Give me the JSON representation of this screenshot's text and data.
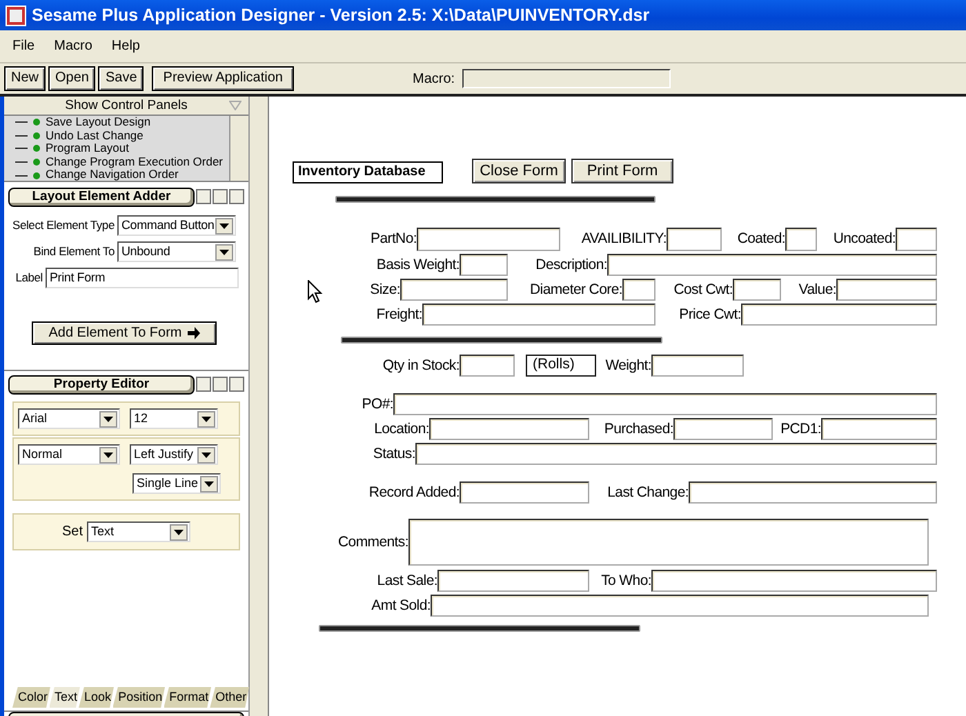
{
  "window": {
    "title": "Sesame Plus Application Designer - Version 2.5: X:\\Data\\PUINVENTORY.dsr"
  },
  "menu": [
    "File",
    "Macro",
    "Help"
  ],
  "toolbar": {
    "buttons": [
      "New",
      "Open",
      "Save",
      "Preview Application"
    ],
    "macro_label": "Macro:"
  },
  "side_panel": {
    "header": "Show Control Panels",
    "tree": [
      "Save Layout Design",
      "Undo Last Change",
      "Program Layout",
      "Change Program Execution Order",
      "Change Navigation Order"
    ],
    "element_adder": {
      "title": "Layout Element Adder",
      "fields": [
        {
          "label": "Select Element Type",
          "value": "Command Button",
          "kind": "select"
        },
        {
          "label": "Bind Element To",
          "value": "Unbound",
          "kind": "select"
        },
        {
          "label": "Label",
          "value": "Print Form",
          "kind": "text"
        }
      ],
      "add_button": "Add Element To Form"
    },
    "property_editor": {
      "title": "Property Editor",
      "groups": [
        [
          "Arial",
          "12"
        ],
        [
          "Normal",
          "Left Justify",
          "Single Line"
        ]
      ],
      "set": {
        "label": "Set",
        "value": "Text"
      }
    },
    "tabs": [
      {
        "label": "Color",
        "selected": false
      },
      {
        "label": "Text",
        "selected": true
      },
      {
        "label": "Look",
        "selected": false
      },
      {
        "label": "Position",
        "selected": false
      },
      {
        "label": "Format",
        "selected": false
      },
      {
        "label": "Other",
        "selected": false
      }
    ]
  },
  "form": {
    "title": "Inventory Database",
    "buttons": [
      "Close Form",
      "Print Form"
    ],
    "fields": [
      {
        "label": "PartNo:",
        "kind": "input"
      },
      {
        "label": "AVAILIBILITY:",
        "kind": "input"
      },
      {
        "label": "Coated:",
        "kind": "input"
      },
      {
        "label": "Uncoated:",
        "kind": "input"
      },
      {
        "label": "Basis Weight:",
        "kind": "input"
      },
      {
        "label": "Description:",
        "kind": "input"
      },
      {
        "label": "Size:",
        "kind": "input"
      },
      {
        "label": "Diameter Core:",
        "kind": "input"
      },
      {
        "label": "Cost Cwt:",
        "kind": "input"
      },
      {
        "label": "Value:",
        "kind": "input"
      },
      {
        "label": "Freight:",
        "kind": "input"
      },
      {
        "label": "Price Cwt:",
        "kind": "input"
      },
      {
        "label": "Qty in Stock:",
        "kind": "input"
      },
      {
        "label": "(Rolls)",
        "kind": "static"
      },
      {
        "label": "Weight:",
        "kind": "input"
      },
      {
        "label": "PO#:",
        "kind": "input"
      },
      {
        "label": "Location:",
        "kind": "input"
      },
      {
        "label": "Purchased:",
        "kind": "input"
      },
      {
        "label": "PCD1:",
        "kind": "input"
      },
      {
        "label": "Status:",
        "kind": "input"
      },
      {
        "label": "Record Added:",
        "kind": "input"
      },
      {
        "label": "Last Change:",
        "kind": "input"
      },
      {
        "label": "Comments:",
        "kind": "textarea"
      },
      {
        "label": "Last Sale:",
        "kind": "input"
      },
      {
        "label": "To Who:",
        "kind": "input"
      },
      {
        "label": "Amt Sold:",
        "kind": "input"
      }
    ]
  }
}
